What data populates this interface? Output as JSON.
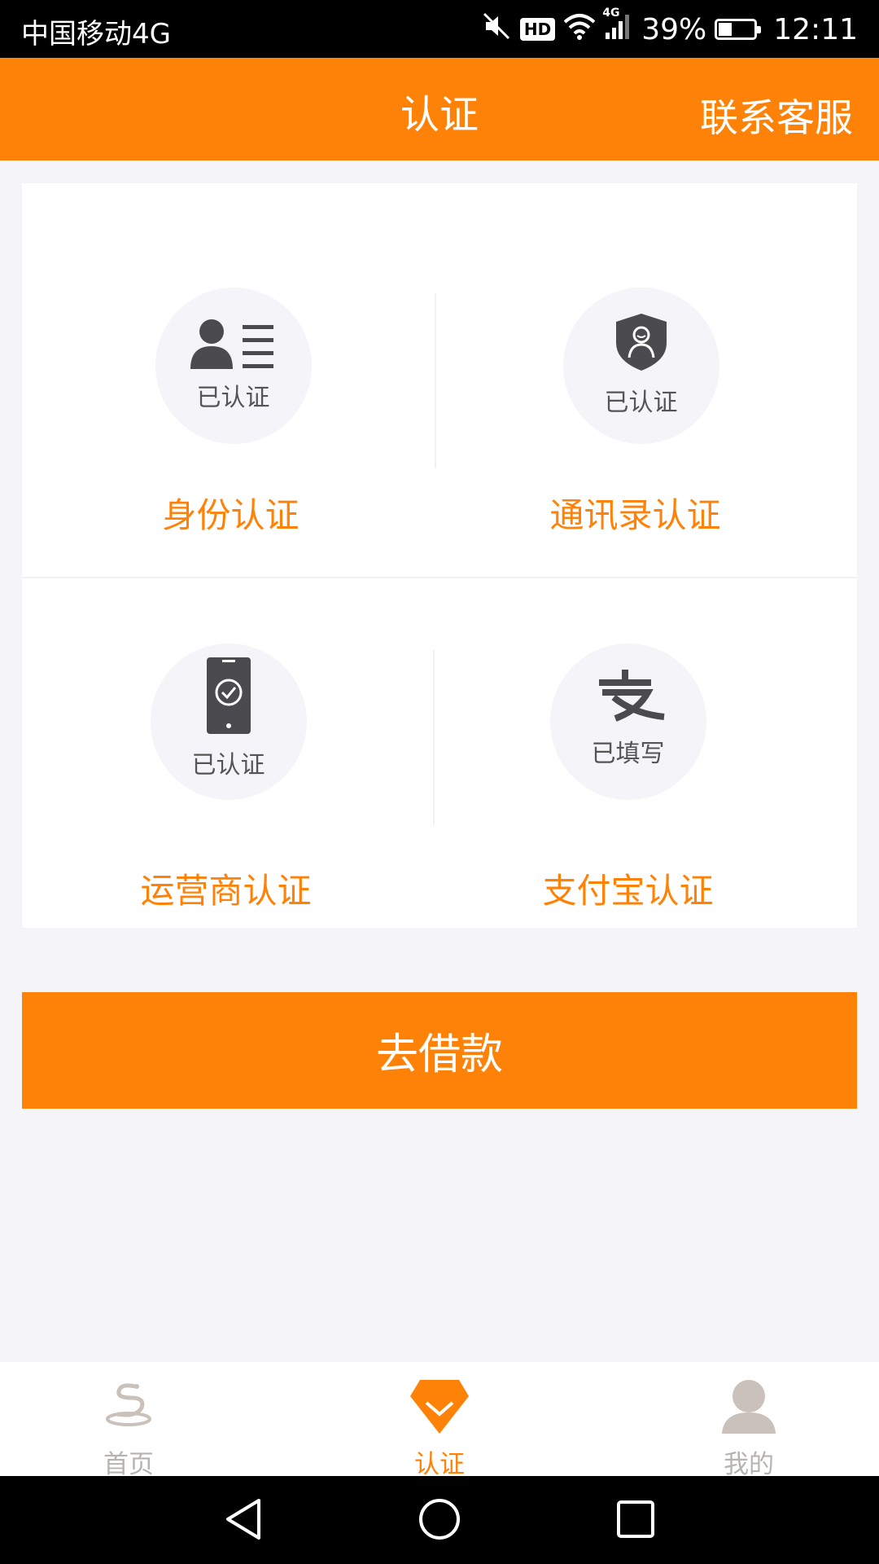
{
  "status_bar": {
    "carrier": "中国移动4G",
    "hd": "HD",
    "network": "4G",
    "battery_percent_text": "39%",
    "battery_level": 0.39,
    "time": "12:11",
    "icons": [
      "mute-icon",
      "hd-icon",
      "wifi-icon",
      "signal-icon",
      "battery-icon"
    ]
  },
  "header": {
    "title": "认证",
    "contact": "联系客服"
  },
  "auth_items": [
    {
      "name": "身份认证",
      "status": "已认证",
      "icon": "id-card-icon"
    },
    {
      "name": "通讯录认证",
      "status": "已认证",
      "icon": "shield-person-icon"
    },
    {
      "name": "运营商认证",
      "status": "已认证",
      "icon": "phone-check-icon"
    },
    {
      "name": "支付宝认证",
      "status": "已填写",
      "icon": "alipay-icon"
    }
  ],
  "borrow_button": "去借款",
  "tabs": [
    {
      "label": "首页",
      "icon": "home-logo-icon",
      "active": false
    },
    {
      "label": "认证",
      "icon": "verify-gem-icon",
      "active": true
    },
    {
      "label": "我的",
      "icon": "profile-icon",
      "active": false
    }
  ],
  "colors": {
    "accent": "#ff8208",
    "background": "#f5f4f9",
    "icon_dark": "#4a4a4f",
    "tab_inactive": "#b7b3b0"
  },
  "nav_bar": {
    "icons": [
      "back-icon",
      "home-icon",
      "recents-icon"
    ]
  }
}
